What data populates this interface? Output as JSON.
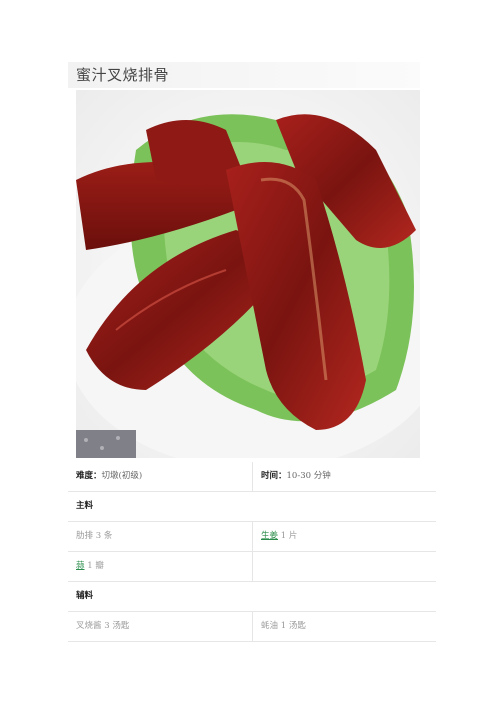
{
  "title": "蜜汁叉烧排骨",
  "photo": {
    "alt": ""
  },
  "info": {
    "difficulty_label": "难度：",
    "difficulty_value": "切墩(初级)",
    "time_label": "时间：",
    "time_value": "10-30 分钟"
  },
  "main_section": "主料",
  "main_items": [
    {
      "name": "肋排",
      "qty": "3 条",
      "link": false
    },
    {
      "name": "生姜",
      "qty": "1 片",
      "link": true
    },
    {
      "name": "蒜",
      "qty": "1 瓣",
      "link": true
    }
  ],
  "aux_section": "辅料",
  "aux_items": [
    {
      "name": "叉烧酱",
      "qty": "3 汤匙"
    },
    {
      "name": "蚝油",
      "qty": "1 汤匙"
    }
  ]
}
